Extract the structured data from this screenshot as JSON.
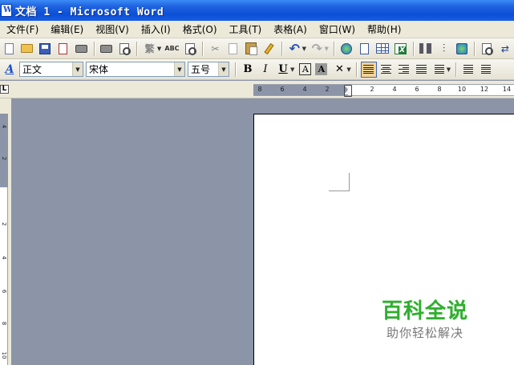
{
  "window": {
    "title": "文档 1 - Microsoft Word"
  },
  "menu": {
    "items": [
      "文件(F)",
      "编辑(E)",
      "视图(V)",
      "插入(I)",
      "格式(O)",
      "工具(T)",
      "表格(A)",
      "窗口(W)",
      "帮助(H)"
    ]
  },
  "standard_toolbar": {
    "icons": [
      "new-document",
      "open",
      "save",
      "permission",
      "print",
      "print-preview",
      "traditional-chinese",
      "spelling",
      "research",
      "cut",
      "copy",
      "paste",
      "format-painter",
      "undo",
      "redo",
      "hyperlink",
      "tables-borders",
      "insert-table",
      "insert-excel",
      "columns",
      "drawing",
      "document-map"
    ],
    "traditional_glyph": "繁",
    "spell_glyph": "ABC",
    "cut_glyph": "✂",
    "undo_glyph": "↶",
    "redo_glyph": "↷",
    "document_map_glyph": "⇄"
  },
  "formatting_toolbar": {
    "style_icon": "A",
    "style_value": "正文",
    "font_value": "宋体",
    "size_value": "五号",
    "bold": "B",
    "italic": "I",
    "underline": "U",
    "char_border": "A",
    "char_shading": "A",
    "active_alignment": "justify"
  },
  "rulers": {
    "horizontal_ticks": [
      "8",
      "6",
      "4",
      "2",
      "2",
      "4",
      "6",
      "8",
      "10",
      "12",
      "14"
    ],
    "vertical_ticks": [
      "4",
      "2",
      "2",
      "4",
      "6",
      "8",
      "10"
    ],
    "corner": "L"
  },
  "watermark": {
    "title": "百科全说",
    "subtitle": "助你轻松解决"
  }
}
